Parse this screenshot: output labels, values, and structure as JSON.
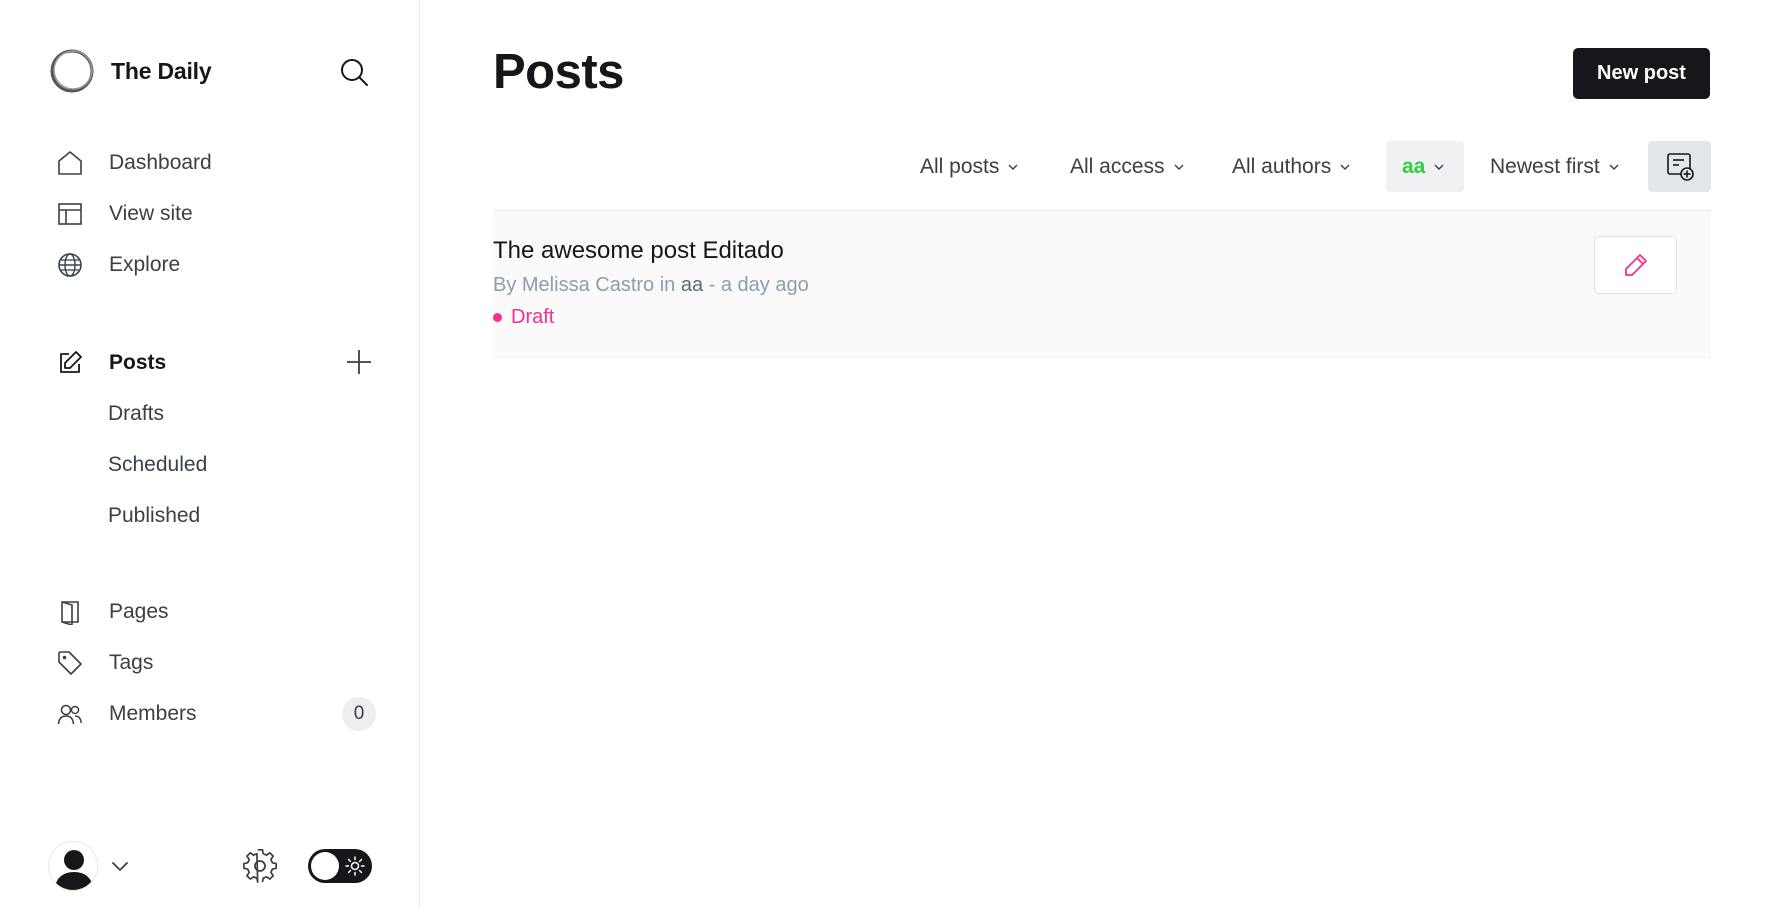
{
  "brand": {
    "name": "The Daily"
  },
  "sidebar": {
    "nav_primary": [
      {
        "label": "Dashboard",
        "icon": "home-icon"
      },
      {
        "label": "View site",
        "icon": "layout-icon"
      },
      {
        "label": "Explore",
        "icon": "globe-icon"
      }
    ],
    "posts": {
      "label": "Posts",
      "icon": "edit-icon",
      "sub": [
        "Drafts",
        "Scheduled",
        "Published"
      ]
    },
    "nav_secondary": [
      {
        "label": "Pages",
        "icon": "page-icon"
      },
      {
        "label": "Tags",
        "icon": "tag-icon"
      },
      {
        "label": "Members",
        "icon": "members-icon",
        "count": "0"
      }
    ]
  },
  "main": {
    "title": "Posts",
    "new_post_label": "New post",
    "filters": {
      "type": "All posts",
      "access": "All access",
      "authors": "All authors",
      "tag": "aa",
      "order": "Newest first"
    },
    "posts": [
      {
        "title": "The awesome post Editado",
        "by": "By Melissa Castro in ",
        "tag": "aa",
        "time": " - a day ago",
        "status": "Draft"
      }
    ]
  },
  "colors": {
    "accent": "#30cf43",
    "draft": "#fb2d8d",
    "primary_button": "#15171a"
  }
}
